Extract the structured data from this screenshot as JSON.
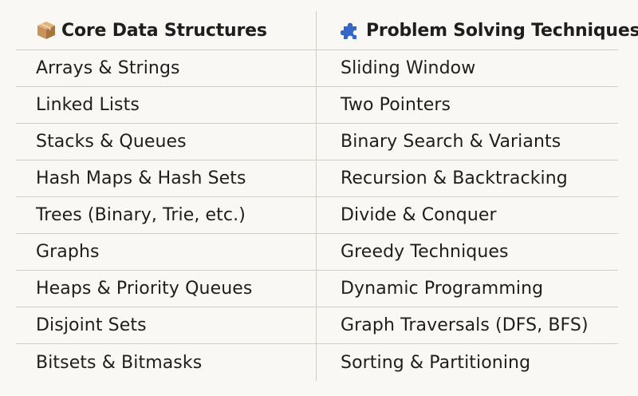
{
  "columns": [
    {
      "title": "Core Data Structures",
      "icon": "package-icon"
    },
    {
      "title": "Problem Solving Techniques",
      "icon": "puzzle-piece-icon"
    }
  ],
  "rows": [
    [
      "Arrays & Strings",
      "Sliding Window"
    ],
    [
      "Linked Lists",
      "Two Pointers"
    ],
    [
      "Stacks & Queues",
      "Binary Search & Variants"
    ],
    [
      "Hash Maps & Hash Sets",
      "Recursion & Backtracking"
    ],
    [
      "Trees (Binary, Trie, etc.)",
      "Divide & Conquer"
    ],
    [
      "Graphs",
      "Greedy Techniques"
    ],
    [
      "Heaps & Priority Queues",
      "Dynamic Programming"
    ],
    [
      "Disjoint Sets",
      "Graph Traversals (DFS, BFS)"
    ],
    [
      "Bitsets & Bitmasks",
      "Sorting & Partitioning"
    ]
  ],
  "colors": {
    "background": "#f9f8f5",
    "divider": "#cfcdc8",
    "text": "#1e1e1e",
    "package_icon": "#c8925a",
    "puzzle_icon": "#3567c8"
  }
}
